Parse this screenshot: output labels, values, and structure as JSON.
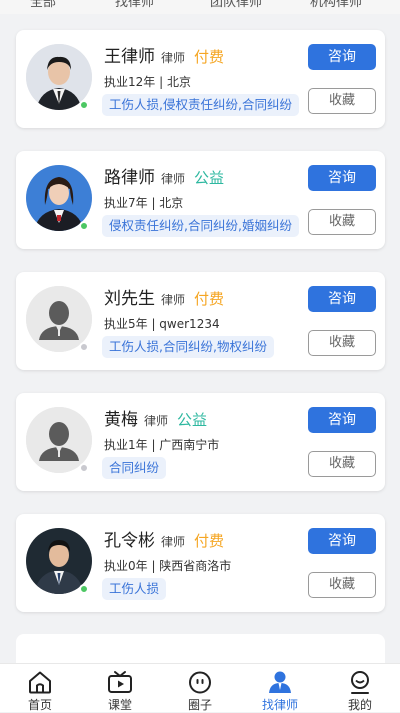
{
  "top_strip": {
    "items": [
      "全部",
      "找律师",
      "团队律师",
      "机构律师"
    ]
  },
  "lawyers": [
    {
      "name": "王律师",
      "role": "律师",
      "badge": "付费",
      "badge_color": "#f5a623",
      "meta": "执业12年 | 北京",
      "tags": "工伤人损,侵权责任纠纷,合同纠纷",
      "online": true,
      "avatar": "photo-male",
      "consult_label": "咨询",
      "fav_label": "收藏"
    },
    {
      "name": "路律师",
      "role": "律师",
      "badge": "公益",
      "badge_color": "#2eb8a0",
      "meta": "执业7年 | 北京",
      "tags": "侵权责任纠纷,合同纠纷,婚姻纠纷",
      "online": true,
      "avatar": "photo-female",
      "consult_label": "咨询",
      "fav_label": "收藏"
    },
    {
      "name": "刘先生",
      "role": "律师",
      "badge": "付费",
      "badge_color": "#f5a623",
      "meta": "执业5年 | qwer1234",
      "tags": "工伤人损,合同纠纷,物权纠纷",
      "online": false,
      "avatar": "default-avatar",
      "consult_label": "咨询",
      "fav_label": "收藏"
    },
    {
      "name": "黄梅",
      "role": "律师",
      "badge": "公益",
      "badge_color": "#2eb8a0",
      "meta": "执业1年 | 广西南宁市",
      "tags": "合同纠纷",
      "online": false,
      "avatar": "default-avatar",
      "consult_label": "咨询",
      "fav_label": "收藏"
    },
    {
      "name": "孔令彬",
      "role": "律师",
      "badge": "付费",
      "badge_color": "#f5a623",
      "meta": "执业0年 | 陕西省商洛市",
      "tags": "工伤人损",
      "online": true,
      "avatar": "photo-male-2",
      "consult_label": "咨询",
      "fav_label": "收藏"
    }
  ],
  "tabbar": {
    "active_color": "#2f73de",
    "tabs": [
      {
        "label": "首页",
        "icon": "home-icon",
        "active": false
      },
      {
        "label": "课堂",
        "icon": "tv-icon",
        "active": false
      },
      {
        "label": "圈子",
        "icon": "circle-chat-icon",
        "active": false
      },
      {
        "label": "找律师",
        "icon": "lawyer-icon",
        "active": true
      },
      {
        "label": "我的",
        "icon": "profile-icon",
        "active": false
      }
    ]
  }
}
